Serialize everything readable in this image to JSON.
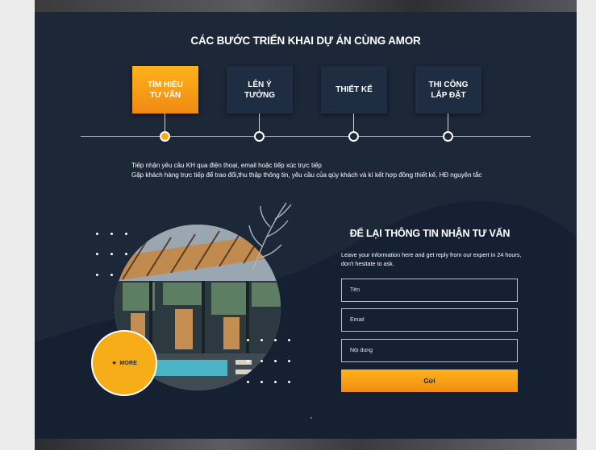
{
  "section": {
    "title": "CÁC BƯỚC TRIỂN KHAI DỰ ÁN CÙNG AMOR"
  },
  "steps": [
    {
      "label": "TÌM HIỂU\nTƯ VẤN",
      "active": true
    },
    {
      "label": "LÊN Ý TƯỞNG",
      "active": false
    },
    {
      "label": "THIẾT KẾ",
      "active": false
    },
    {
      "label": "THI CÔNG\nLẮP ĐẶT",
      "active": false
    }
  ],
  "step_description": {
    "line1": "Tiếp nhận yêu cầu KH qua điện thoại, email hoặc tiếp xúc trực tiếp",
    "line2": "Gặp khách hàng trực tiếp để trao đổi,thu thập thông tin, yêu cầu của qúy khách và kí kết hợp đồng thiết kế, HĐ nguyên tắc"
  },
  "badge": {
    "logo_text": "MORE"
  },
  "form": {
    "title": "ĐỂ LẠI THÔNG TIN NHẬN TƯ VẤN",
    "description": "Leave your information here and get reply from our expert in 24 hours, don't hesitate to ask.",
    "name_placeholder": "Tên",
    "email_placeholder": "Email",
    "message_placeholder": "Nội dung",
    "submit_label": "Gửi"
  },
  "colors": {
    "background": "#1c2738",
    "accent": "#f6a91a",
    "card": "#1f2d42"
  }
}
